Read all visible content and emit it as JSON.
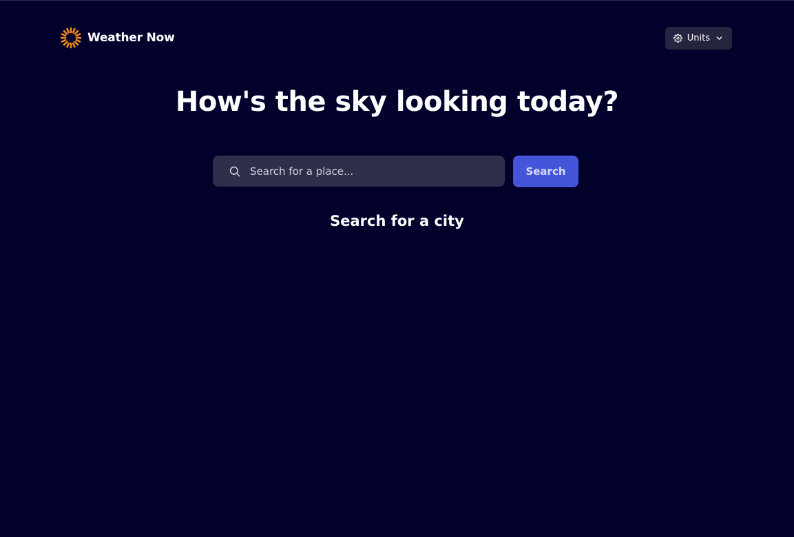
{
  "header": {
    "brand_name": "Weather Now",
    "logo_icon": "sun-logo-icon",
    "units_label": "Units",
    "units_icon": "gear-icon",
    "units_dropdown_icon": "chevron-down-icon"
  },
  "main": {
    "title": "How's the sky looking today?",
    "search": {
      "placeholder": "Search for a place...",
      "value": "",
      "icon": "search-icon",
      "button_label": "Search"
    },
    "status_message": "Search for a city"
  },
  "colors": {
    "background": "#02012b",
    "surface": "#302f4b",
    "accent": "#4455da",
    "logo": "#f78a1e"
  }
}
